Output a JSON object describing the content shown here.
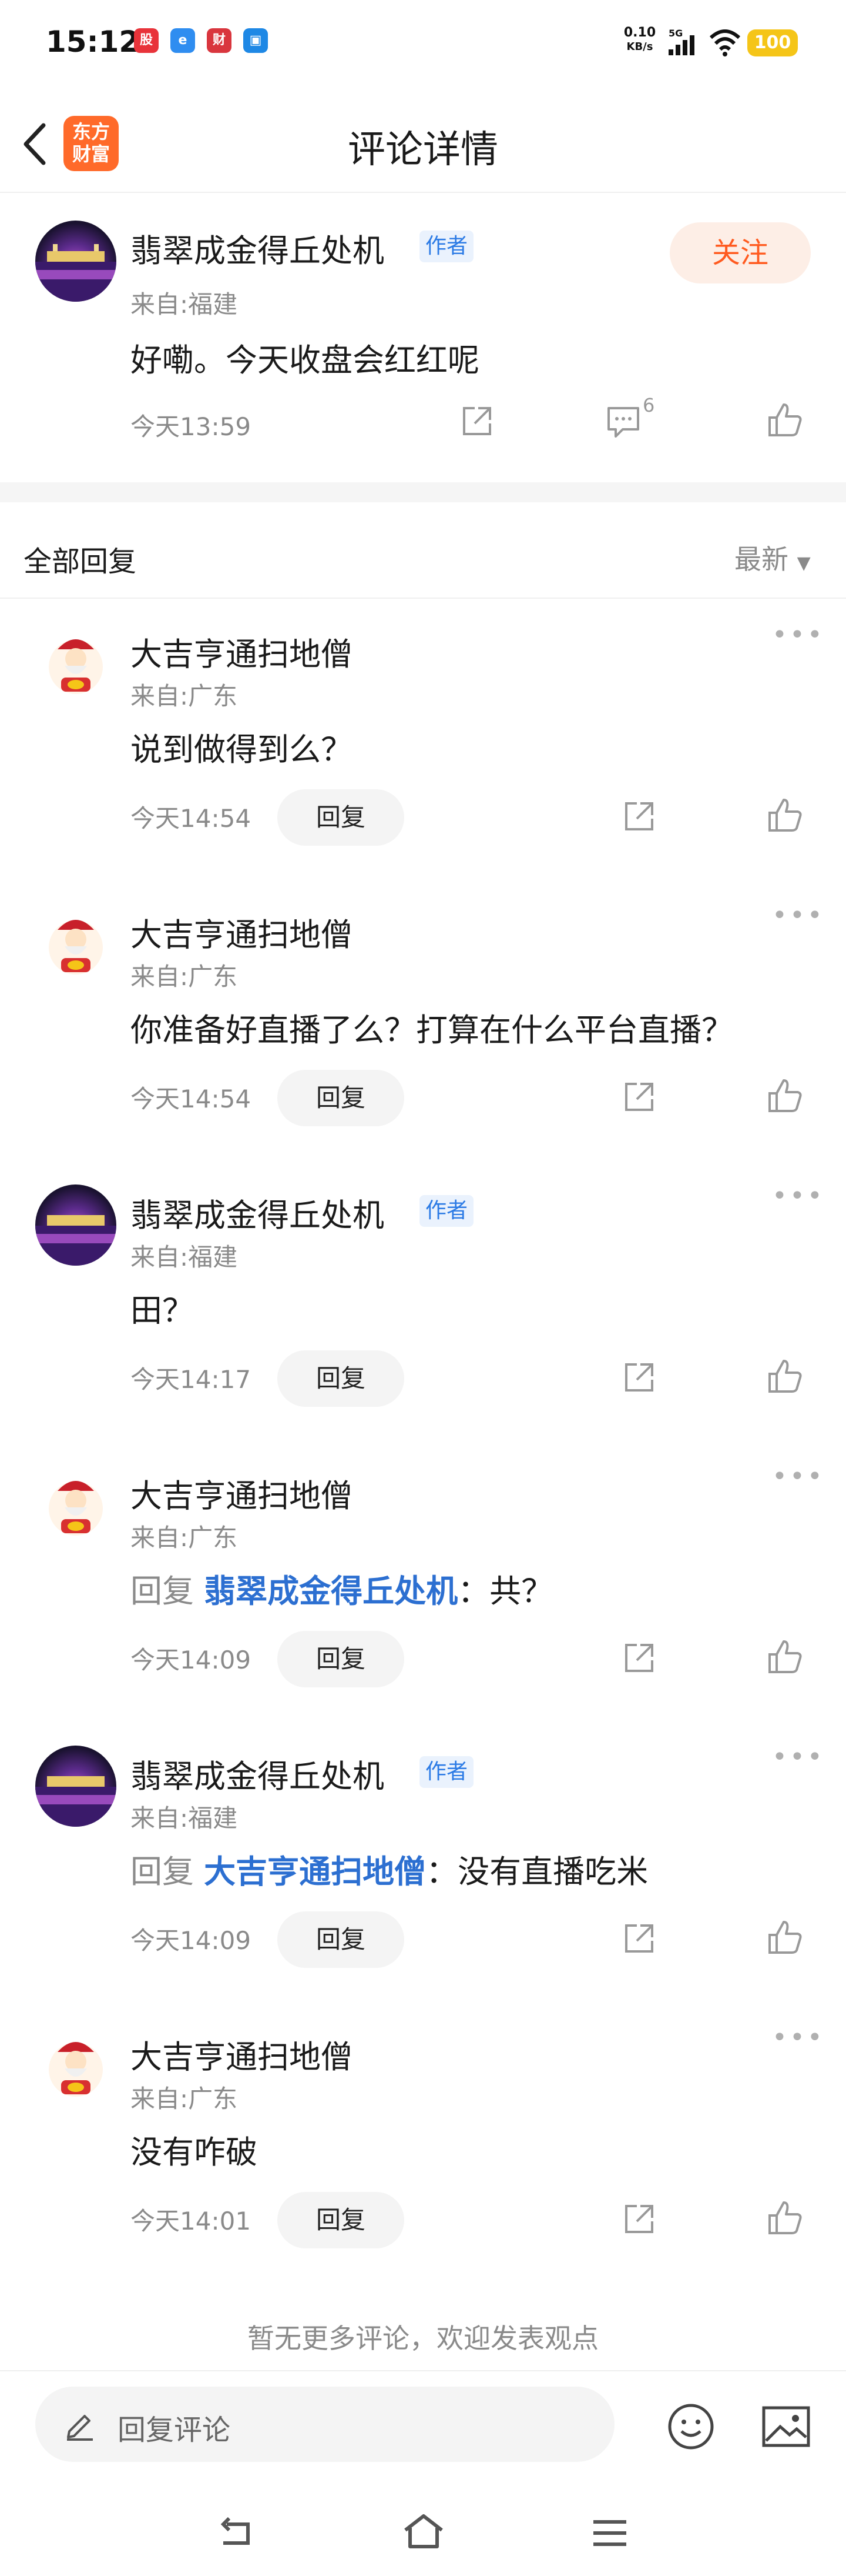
{
  "status_bar": {
    "time": "15:12",
    "net_speed_value": "0.10",
    "net_speed_unit": "KB/s",
    "network": "5G",
    "battery": "100"
  },
  "header": {
    "logo_line1": "东方",
    "logo_line2": "财富",
    "title": "评论详情"
  },
  "main_comment": {
    "username": "翡翠成金得丘处机",
    "author_tag": "作者",
    "location": "来自:福建",
    "content": "好嘞。今天收盘会红红呢",
    "timestamp": "今天13:59",
    "reply_count": "6",
    "follow_label": "关注"
  },
  "replies_header": {
    "title": "全部回复",
    "sort": "最新"
  },
  "reply_prefix": "回复",
  "reply_button_label": "回复",
  "replies": [
    {
      "username": "大吉亨通扫地僧",
      "author_tag": "",
      "location": "来自:广东",
      "content": "说到做得到么？",
      "mention": "",
      "mention_suffix": "",
      "timestamp": "今天14:54"
    },
    {
      "username": "大吉亨通扫地僧",
      "author_tag": "",
      "location": "来自:广东",
      "content": "你准备好直播了么？打算在什么平台直播？",
      "mention": "",
      "mention_suffix": "",
      "timestamp": "今天14:54"
    },
    {
      "username": "翡翠成金得丘处机",
      "author_tag": "作者",
      "location": "来自:福建",
      "content": "田？",
      "mention": "",
      "mention_suffix": "",
      "timestamp": "今天14:17"
    },
    {
      "username": "大吉亨通扫地僧",
      "author_tag": "",
      "location": "来自:广东",
      "content": "",
      "mention": "翡翠成金得丘处机",
      "mention_suffix": "：共？",
      "timestamp": "今天14:09"
    },
    {
      "username": "翡翠成金得丘处机",
      "author_tag": "作者",
      "location": "来自:福建",
      "content": "",
      "mention": "大吉亨通扫地僧",
      "mention_suffix": "：没有直播吃米",
      "timestamp": "今天14:09"
    },
    {
      "username": "大吉亨通扫地僧",
      "author_tag": "",
      "location": "来自:广东",
      "content": "没有咋破",
      "mention": "",
      "mention_suffix": "",
      "timestamp": "今天14:01"
    }
  ],
  "footer_note": "暂无更多评论，欢迎发表观点",
  "bottom_bar": {
    "input_placeholder": "回复评论"
  },
  "colors": {
    "accent": "#ff5a1f",
    "link": "#2c6fd1",
    "author_tag": "#2c7be5",
    "battery": "#f5c518"
  }
}
